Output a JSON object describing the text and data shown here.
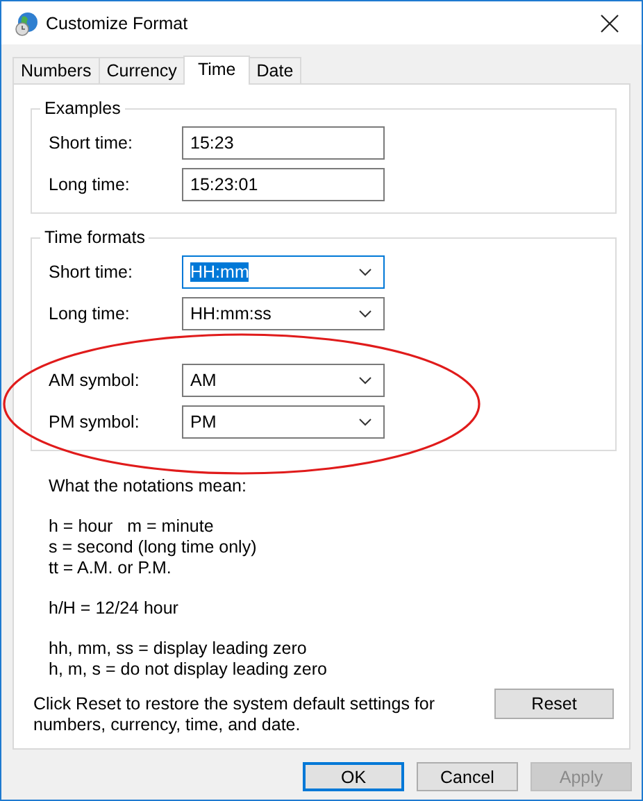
{
  "window": {
    "title": "Customize Format"
  },
  "tabs": [
    {
      "label": "Numbers",
      "selected": false
    },
    {
      "label": "Currency",
      "selected": false
    },
    {
      "label": "Time",
      "selected": true
    },
    {
      "label": "Date",
      "selected": false
    }
  ],
  "examples": {
    "title": "Examples",
    "fields": [
      {
        "label": "Short time:",
        "value": "15:23"
      },
      {
        "label": "Long time:",
        "value": "15:23:01"
      }
    ]
  },
  "time_formats": {
    "title": "Time formats",
    "fields": [
      {
        "label": "Short time:",
        "value": "HH:mm",
        "focused": true
      },
      {
        "label": "Long time:",
        "value": "HH:mm:ss",
        "focused": false
      },
      {
        "label": "AM symbol:",
        "value": "AM",
        "focused": false
      },
      {
        "label": "PM symbol:",
        "value": "PM",
        "focused": false
      }
    ]
  },
  "notes": {
    "heading": "What the notations mean:",
    "groups": [
      [
        "h = hour   m = minute",
        "s = second (long time only)",
        "tt = A.M. or P.M."
      ],
      [
        "h/H = 12/24 hour"
      ],
      [
        "hh, mm, ss = display leading zero",
        "h, m, s = do not display leading zero"
      ]
    ]
  },
  "reset": {
    "text": "Click Reset to restore the system default settings for numbers, currency, time, and date.",
    "button": "Reset"
  },
  "buttons": [
    {
      "label": "OK",
      "default": true,
      "disabled": false
    },
    {
      "label": "Cancel",
      "default": false,
      "disabled": false
    },
    {
      "label": "Apply",
      "default": false,
      "disabled": true
    }
  ]
}
